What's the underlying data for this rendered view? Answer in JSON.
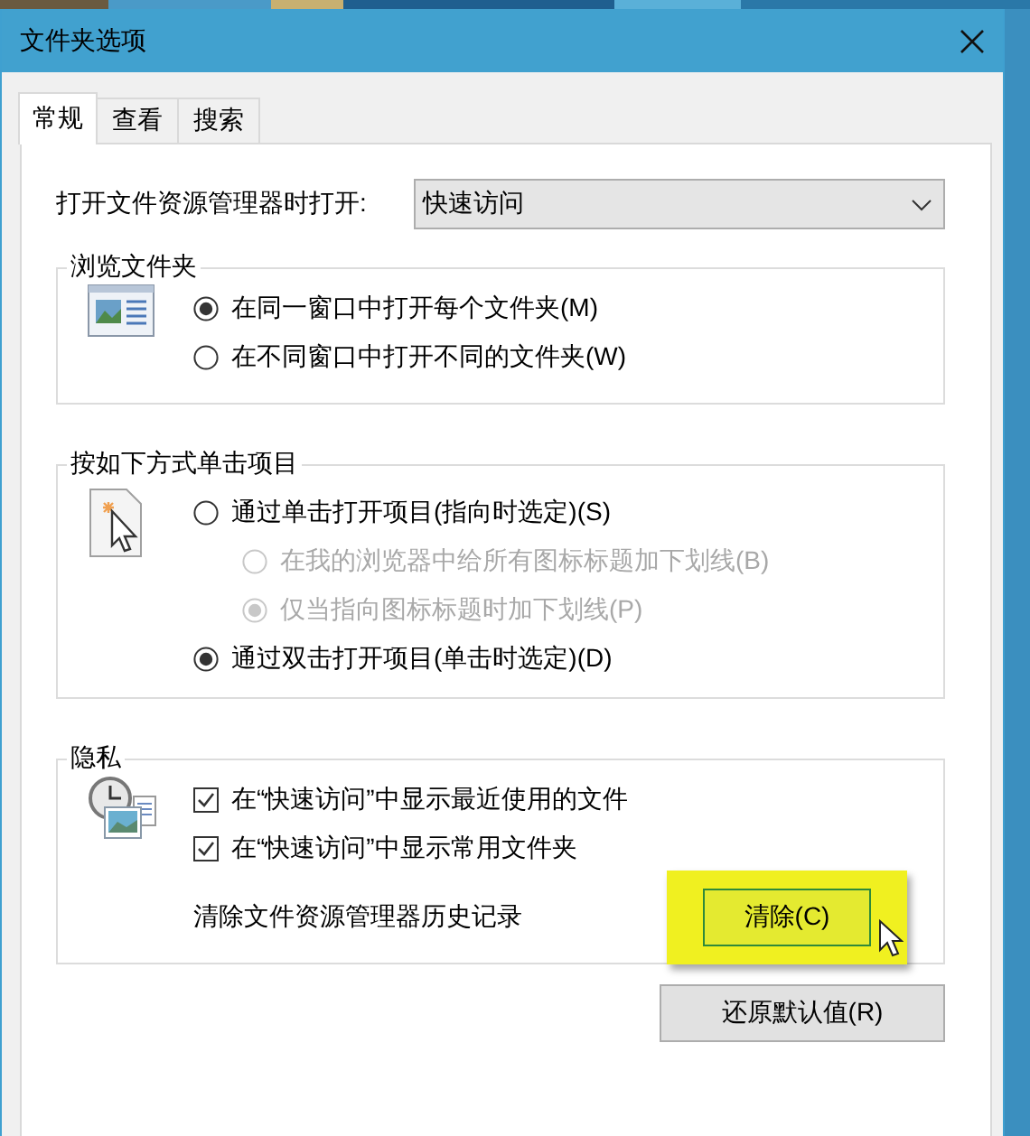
{
  "window": {
    "title": "文件夹选项"
  },
  "tabs": [
    {
      "label": "常规",
      "selected": true
    },
    {
      "label": "查看",
      "selected": false
    },
    {
      "label": "搜索",
      "selected": false
    }
  ],
  "open_explorer": {
    "label": "打开文件资源管理器时打开:",
    "value": "快速访问"
  },
  "groups": [
    {
      "title": "浏览文件夹",
      "options": [
        {
          "kind": "radio",
          "label": "在同一窗口中打开每个文件夹(M)",
          "selected": true,
          "disabled": false
        },
        {
          "kind": "radio",
          "label": "在不同窗口中打开不同的文件夹(W)",
          "selected": false,
          "disabled": false
        }
      ]
    },
    {
      "title": "按如下方式单击项目",
      "options": [
        {
          "kind": "radio",
          "label": "通过单击打开项目(指向时选定)(S)",
          "selected": false,
          "disabled": false,
          "children": [
            {
              "kind": "radio",
              "label": "在我的浏览器中给所有图标标题加下划线(B)",
              "selected": false,
              "disabled": true
            },
            {
              "kind": "radio",
              "label": "仅当指向图标标题时加下划线(P)",
              "selected": true,
              "disabled": true
            }
          ]
        },
        {
          "kind": "radio",
          "label": "通过双击打开项目(单击时选定)(D)",
          "selected": true,
          "disabled": false
        }
      ]
    },
    {
      "title": "隐私",
      "options": [
        {
          "kind": "checkbox",
          "label": "在“快速访问”中显示最近使用的文件",
          "checked": true
        },
        {
          "kind": "checkbox",
          "label": "在“快速访问”中显示常用文件夹",
          "checked": true
        },
        {
          "kind": "action",
          "label": "清除文件资源管理器历史记录",
          "button": "清除(C)",
          "highlighted": true
        }
      ]
    }
  ],
  "buttons": [
    "还原默认值(R)"
  ]
}
